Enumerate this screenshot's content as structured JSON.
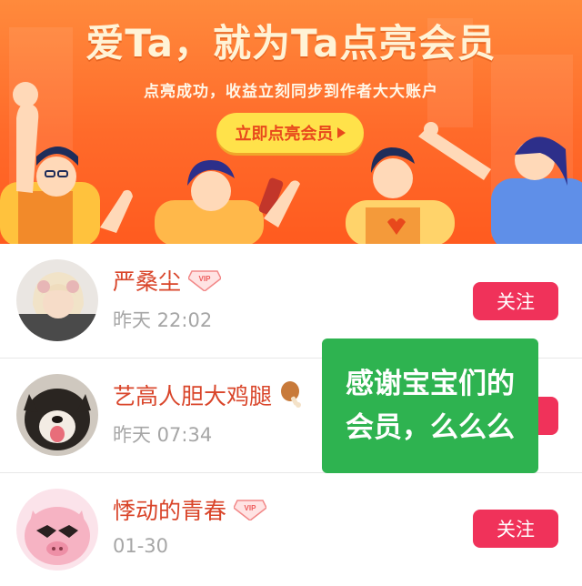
{
  "banner": {
    "title": "爱Ta，就为Ta点亮会员",
    "subtitle": "点亮成功，收益立刻同步到作者大大账户",
    "cta_label": "立即点亮会员"
  },
  "members": [
    {
      "name": "严桑尘",
      "time": "昨天 22:02",
      "follow_label": "关注",
      "badge": "vip-badge-icon"
    },
    {
      "name": "艺高人胆大鸡腿",
      "time": "昨天 07:34",
      "follow_label": "关注",
      "badge": "drumstick-icon"
    },
    {
      "name": "悸动的青春",
      "time": "01-30",
      "follow_label": "关注",
      "badge": "vip-badge-icon"
    }
  ],
  "caption": {
    "line1": "感谢宝宝们的",
    "line2": "会员，么么么"
  },
  "colors": {
    "banner_orange": "#ff6a2a",
    "cta_yellow": "#ffe24a",
    "name_red": "#d9452a",
    "follow_pink": "#f0325a",
    "caption_green": "#2eb350"
  }
}
